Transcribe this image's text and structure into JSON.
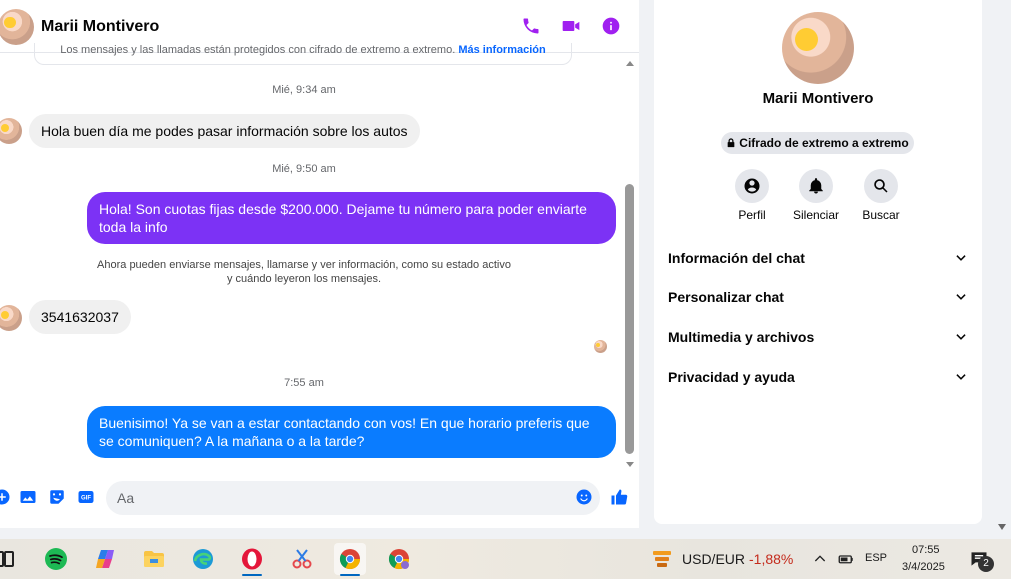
{
  "header": {
    "contact_name": "Marii Montivero",
    "icons": [
      "phone-icon",
      "video-icon",
      "info-icon"
    ],
    "accent_color": "#a020f0"
  },
  "encryption_notice": {
    "text": "Los mensajes y las llamadas están protegidos con cifrado de extremo a extremo.",
    "link": "Más información"
  },
  "messages": [
    {
      "type": "timestamp",
      "text": "Mié, 9:34 am"
    },
    {
      "type": "incoming",
      "text": "Hola buen día me podes pasar información sobre los autos"
    },
    {
      "type": "timestamp",
      "text": "Mié, 9:50 am"
    },
    {
      "type": "outgoing",
      "color": "#7c32f5",
      "text": "Hola! Son cuotas fijas desde $200.000. Dejame tu número para poder enviarte toda la info"
    },
    {
      "type": "system",
      "line1": "Ahora pueden enviarse mensajes, llamarse y ver información, como su estado activo",
      "line2": "y cuándo leyeron los mensajes."
    },
    {
      "type": "incoming",
      "text": "3541632037"
    },
    {
      "type": "timestamp",
      "text": "7:55 am"
    },
    {
      "type": "outgoing",
      "color": "#0a7cff",
      "text": "Buenisimo! Ya se van a estar contactando con vos! En que horario preferis que se comuniquen? A la mañana o a la tarde?"
    }
  ],
  "composer": {
    "placeholder": "Aa",
    "icons": [
      "plus-icon",
      "image-icon",
      "sticker-icon",
      "gif-icon",
      "emoji-icon",
      "like-icon"
    ]
  },
  "info_panel": {
    "name": "Marii Montivero",
    "encryption_badge": "Cifrado de extremo a extremo",
    "actions": [
      {
        "label": "Perfil",
        "icon": "profile-icon"
      },
      {
        "label": "Silenciar",
        "icon": "bell-icon"
      },
      {
        "label": "Buscar",
        "icon": "search-icon"
      }
    ],
    "sections": [
      {
        "label": "Información del chat"
      },
      {
        "label": "Personalizar chat"
      },
      {
        "label": "Multimedia y archivos"
      },
      {
        "label": "Privacidad y ayuda"
      }
    ]
  },
  "taskbar": {
    "apps": [
      "task-view-icon",
      "spotify-icon",
      "copilot-icon",
      "file-explorer-icon",
      "edge-icon",
      "opera-icon",
      "snipping-tool-icon",
      "chrome-icon",
      "chrome-profile-icon"
    ],
    "stock_label": "USD/EUR",
    "stock_change": "-1,88%",
    "stock_change_color": "#c42b1c",
    "language": "ESP",
    "time": "07:55",
    "date": "3/4/2025",
    "notification_count": "2"
  }
}
